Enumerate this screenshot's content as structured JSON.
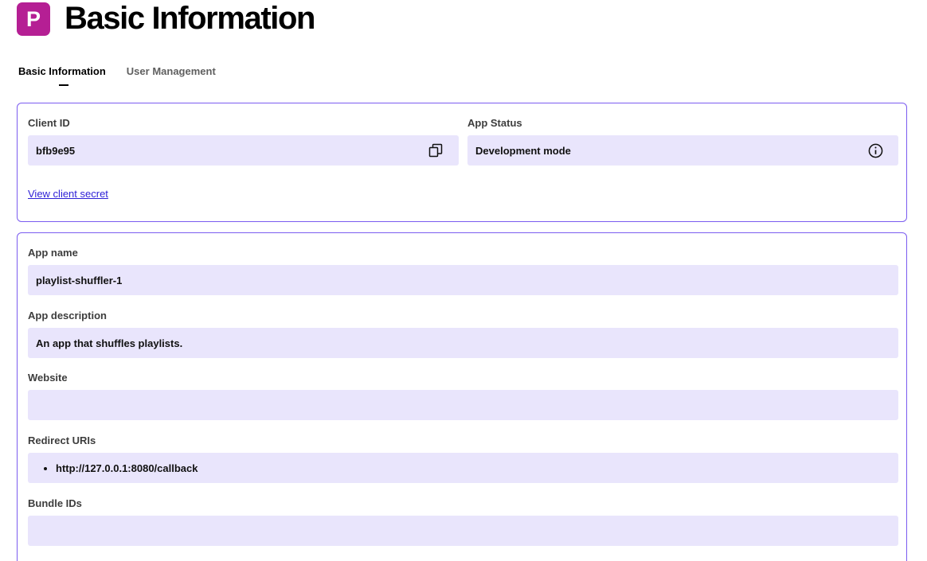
{
  "header": {
    "logo_letter": "P",
    "title": "Basic Information"
  },
  "tabs": [
    {
      "label": "Basic Information",
      "active": true
    },
    {
      "label": "User Management",
      "active": false
    }
  ],
  "credentials": {
    "client_id_label": "Client ID",
    "client_id_value": "bfb9e95",
    "copy_icon": "copy-icon",
    "app_status_label": "App Status",
    "app_status_value": "Development mode",
    "info_icon": "info-icon",
    "view_secret_link": "View client secret"
  },
  "app_details": {
    "app_name_label": "App name",
    "app_name_value": "playlist-shuffler-1",
    "app_description_label": "App description",
    "app_description_value": "An app that shuffles playlists.",
    "website_label": "Website",
    "website_value": "",
    "redirect_uris_label": "Redirect URIs",
    "redirect_uris": [
      "http://127.0.0.1:8080/callback"
    ],
    "bundle_ids_label": "Bundle IDs",
    "bundle_ids_value": ""
  },
  "colors": {
    "logo_bg": "#b51f94",
    "card_border": "#7b5cf0",
    "field_bg": "#e9e5fc",
    "link": "#2d1fd6"
  }
}
